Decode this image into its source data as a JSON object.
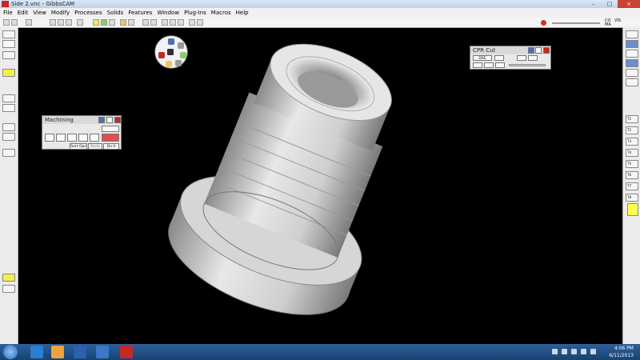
{
  "window": {
    "title": "Side 2.vnc - GibbsCAM"
  },
  "window_controls": {
    "minimize": "–",
    "maximize": "□",
    "close": "×"
  },
  "menu": [
    "File",
    "Edit",
    "View",
    "Modify",
    "Processes",
    "Solids",
    "Features",
    "Window",
    "Plug-Ins",
    "Macros",
    "Help"
  ],
  "toolbar_readout": {
    "top_left": "CO",
    "top_right": "VIS",
    "bottom_right": "MA"
  },
  "machining_panel": {
    "title": "Machining",
    "sort_ops": "Sort Ops",
    "redo": "Redo",
    "do_it": "Do It"
  },
  "cpr_panel": {
    "title": "CPR Cut",
    "transport_label": "DSE"
  },
  "right_labels": [
    "T1",
    "T2",
    "T3",
    "T4",
    "T5",
    "T6",
    "T7",
    "T8"
  ],
  "taskbar": {
    "time": "4:06 PM",
    "date": "6/11/2013"
  },
  "colors": {
    "accent": "#1e4f84",
    "highlight": "#ffff4a",
    "model": "#cfcfcf"
  }
}
